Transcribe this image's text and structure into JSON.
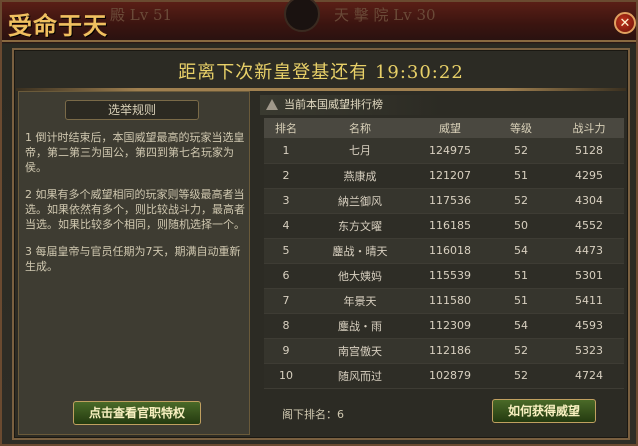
{
  "window": {
    "title": "受命于天",
    "ghost_left": "殿 Lv 51",
    "ghost_right": "天 擊 院 Lv 30",
    "close_icon": "close-icon"
  },
  "countdown": {
    "text": "距离下次新皇登基还有 19:30:22"
  },
  "rules": {
    "heading": "选举规则",
    "paragraphs": [
      "1 倒计时结束后，本国威望最高的玩家当选皇帝，第二第三为国公，第四到第七名玩家为侯。",
      "2 如果有多个威望相同的玩家则等级最高者当选。如果依然有多个，则比较战斗力，最高者当选。如果比较多个相同，则随机选择一个。",
      "3 每届皇帝与官员任期为7天，期满自动重新生成。"
    ],
    "button": "点击查看官职特权"
  },
  "ranking": {
    "tag": "当前本国威望排行榜",
    "columns": [
      "排名",
      "名称",
      "威望",
      "等级",
      "战斗力"
    ],
    "rows": [
      [
        "1",
        "七月",
        "124975",
        "52",
        "5128"
      ],
      [
        "2",
        "燕康成",
        "121207",
        "51",
        "4295"
      ],
      [
        "3",
        "納兰御风",
        "117536",
        "52",
        "4304"
      ],
      [
        "4",
        "东方文曜",
        "116185",
        "50",
        "4552"
      ],
      [
        "5",
        "鏖战・晴天",
        "116018",
        "54",
        "4473"
      ],
      [
        "6",
        "他大姨妈",
        "115539",
        "51",
        "5301"
      ],
      [
        "7",
        "年景天",
        "111580",
        "51",
        "5411"
      ],
      [
        "8",
        "鏖战・雨",
        "112309",
        "54",
        "4593"
      ],
      [
        "9",
        "南宫傲天",
        "112186",
        "52",
        "5323"
      ],
      [
        "10",
        "随风而过",
        "102879",
        "52",
        "4724"
      ]
    ],
    "my_rank": "阁下排名：6",
    "button": "如何获得威望"
  }
}
